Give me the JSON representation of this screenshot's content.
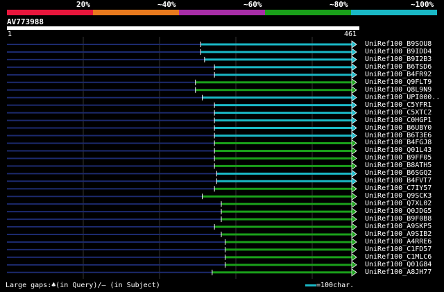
{
  "legend": {
    "colors": [
      "#e8163c",
      "#e87a1e",
      "#a82ea8",
      "#1aa01a",
      "#1ab8c6"
    ],
    "labels": [
      "20%",
      "~40%",
      "~60%",
      "~80%",
      "~100%"
    ]
  },
  "query": {
    "name": "AV773988",
    "start": "1",
    "end": "461"
  },
  "chart_data": {
    "type": "bar",
    "x_range": [
      1,
      461
    ],
    "identity_colors": {
      "~80%": "#1aa01a",
      "~100%": "#1ab8c6"
    },
    "hits": [
      {
        "name": "UniRef100_B9SOU8",
        "start": 256,
        "end": 461,
        "identity": "~100%"
      },
      {
        "name": "UniRef100_B9IDD4",
        "start": 256,
        "end": 461,
        "identity": "~100%"
      },
      {
        "name": "UniRef100_B9I2B3",
        "start": 261,
        "end": 461,
        "identity": "~100%"
      },
      {
        "name": "UniRef100_B6TSD6",
        "start": 274,
        "end": 461,
        "identity": "~100%"
      },
      {
        "name": "UniRef100_B4FR92",
        "start": 274,
        "end": 461,
        "identity": "~100%"
      },
      {
        "name": "UniRef100_Q9FLT9",
        "start": 249,
        "end": 461,
        "identity": "~80%"
      },
      {
        "name": "UniRef100_Q8L9N9",
        "start": 249,
        "end": 461,
        "identity": "~80%"
      },
      {
        "name": "UniRef100_UPI000..",
        "start": 258,
        "end": 461,
        "identity": "~100%"
      },
      {
        "name": "UniRef100_C5YFR1",
        "start": 274,
        "end": 461,
        "identity": "~100%"
      },
      {
        "name": "UniRef100_C5XTC2",
        "start": 274,
        "end": 461,
        "identity": "~100%"
      },
      {
        "name": "UniRef100_C0HGP1",
        "start": 274,
        "end": 461,
        "identity": "~100%"
      },
      {
        "name": "UniRef100_B6UBY0",
        "start": 274,
        "end": 461,
        "identity": "~100%"
      },
      {
        "name": "UniRef100_B6T3E6",
        "start": 274,
        "end": 461,
        "identity": "~100%"
      },
      {
        "name": "UniRef100_B4FGJ8",
        "start": 274,
        "end": 461,
        "identity": "~80%"
      },
      {
        "name": "UniRef100_Q01L43",
        "start": 274,
        "end": 461,
        "identity": "~80%"
      },
      {
        "name": "UniRef100_B9FF05",
        "start": 274,
        "end": 461,
        "identity": "~80%"
      },
      {
        "name": "UniRef100_B8ATH5",
        "start": 274,
        "end": 461,
        "identity": "~80%"
      },
      {
        "name": "UniRef100_B6SGQ2",
        "start": 277,
        "end": 461,
        "identity": "~100%"
      },
      {
        "name": "UniRef100_B4FVT7",
        "start": 277,
        "end": 461,
        "identity": "~100%"
      },
      {
        "name": "UniRef100_C7IY57",
        "start": 274,
        "end": 461,
        "identity": "~80%"
      },
      {
        "name": "UniRef100_Q9SCK3",
        "start": 258,
        "end": 461,
        "identity": "~80%"
      },
      {
        "name": "UniRef100_Q7XL02",
        "start": 283,
        "end": 461,
        "identity": "~80%"
      },
      {
        "name": "UniRef100_Q0JDG5",
        "start": 283,
        "end": 461,
        "identity": "~80%"
      },
      {
        "name": "UniRef100_B9F0B8",
        "start": 283,
        "end": 461,
        "identity": "~80%"
      },
      {
        "name": "UniRef100_A9SKP5",
        "start": 274,
        "end": 461,
        "identity": "~80%"
      },
      {
        "name": "UniRef100_A9SIB2",
        "start": 283,
        "end": 461,
        "identity": "~80%"
      },
      {
        "name": "UniRef100_A4RRE6",
        "start": 288,
        "end": 461,
        "identity": "~80%"
      },
      {
        "name": "UniRef100_C1FD57",
        "start": 288,
        "end": 461,
        "identity": "~80%"
      },
      {
        "name": "UniRef100_C1MLC6",
        "start": 288,
        "end": 461,
        "identity": "~80%"
      },
      {
        "name": "UniRef100_Q01G84",
        "start": 288,
        "end": 461,
        "identity": "~80%"
      },
      {
        "name": "UniRef100_A8JH77",
        "start": 271,
        "end": 461,
        "identity": "~80%"
      }
    ]
  },
  "footer": {
    "gaps_text": "Large gaps:♣(in Query)/– (in Subject)",
    "scale_text": "=100char."
  }
}
